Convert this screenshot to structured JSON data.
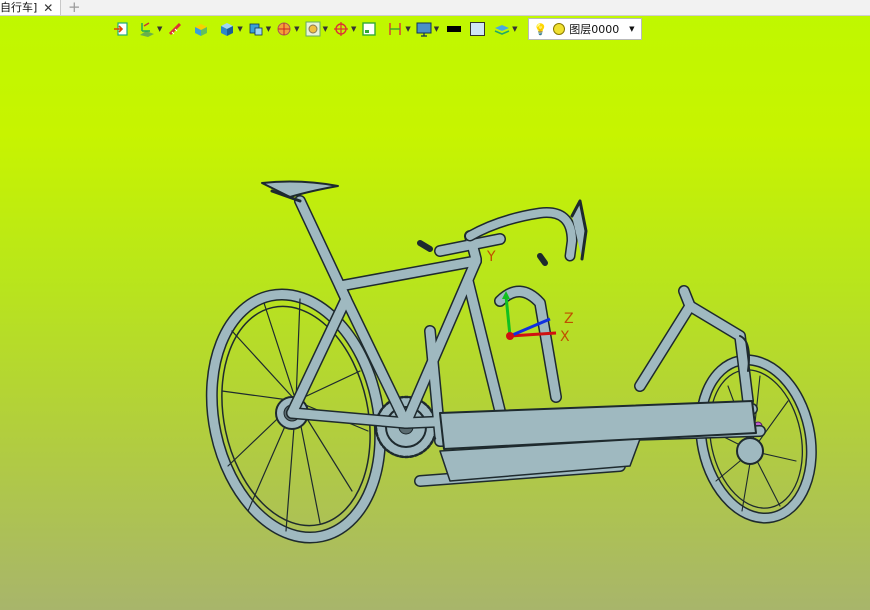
{
  "tab": {
    "title": "自行车]",
    "close": "✕",
    "add": "+"
  },
  "toolbar": {
    "layer": {
      "value": "图层0000"
    }
  },
  "axes": {
    "x": "X",
    "y": "Y",
    "z": "Z"
  },
  "colors": {
    "background_top": "#bff800",
    "background_bottom": "#a8b56b",
    "model": "#9fb9c0",
    "model_outline": "#1e2a2e",
    "axis_x": "#d01010",
    "axis_y": "#10c020",
    "axis_z": "#1030e0"
  }
}
